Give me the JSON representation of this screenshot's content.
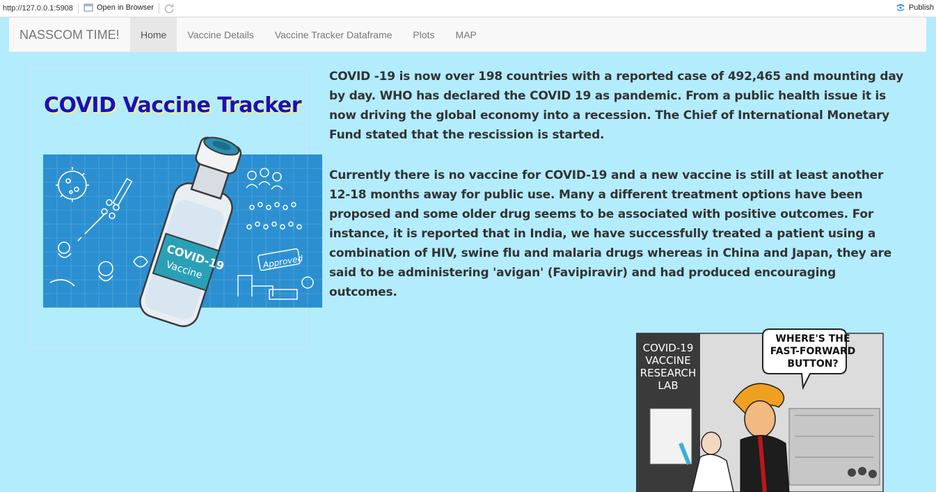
{
  "viewer": {
    "url": "http://127.0.0.1:5908",
    "open_in_browser": "Open in Browser",
    "publish": "Publish"
  },
  "navbar": {
    "brand": "NASSCOM TIME!",
    "items": [
      {
        "label": "Home",
        "active": true
      },
      {
        "label": "Vaccine Details",
        "active": false
      },
      {
        "label": "Vaccine Tracker Dataframe",
        "active": false
      },
      {
        "label": "Plots",
        "active": false
      },
      {
        "label": "MAP",
        "active": false
      }
    ]
  },
  "hero": {
    "title": "COVID Vaccine Tracker",
    "vial_label_1": "COVID-19",
    "vial_label_2": "Vaccine",
    "stamp": "Approved"
  },
  "content": {
    "paragraph_1": "COVID -19 is now over 198 countries with a reported case of 492,465 and mounting day by day. WHO has declared the COVID 19 as pandemic. From a public health issue it is now driving the global economy into a recession. The Chief of International Monetary Fund stated that the rescission is started.",
    "paragraph_2": "Currently there is no vaccine for COVID-19 and a new vaccine is still at least another 12-18 months away for public use. Many a different treatment options have been proposed and some older drug seems to be associated with positive outcomes. For instance, it is reported that in India, we have successfully treated a patient using a combination of HIV, swine flu and malaria drugs whereas in China and Japan, they are said to be administering 'avigan' (Favipiravir) and had produced encouraging outcomes."
  },
  "cartoon": {
    "lab_sign": [
      "COVID-19",
      "VACCINE",
      "RESEARCH",
      "LAB"
    ],
    "speech": [
      "WHERE'S THE",
      "FAST-FORWARD",
      "BUTTON?"
    ]
  },
  "colors": {
    "page_bg": "#b3ecfd",
    "title_blue": "#1a10b8",
    "title_shadow": "#f6ef7a",
    "panel_blue": "#2b8fd1"
  }
}
